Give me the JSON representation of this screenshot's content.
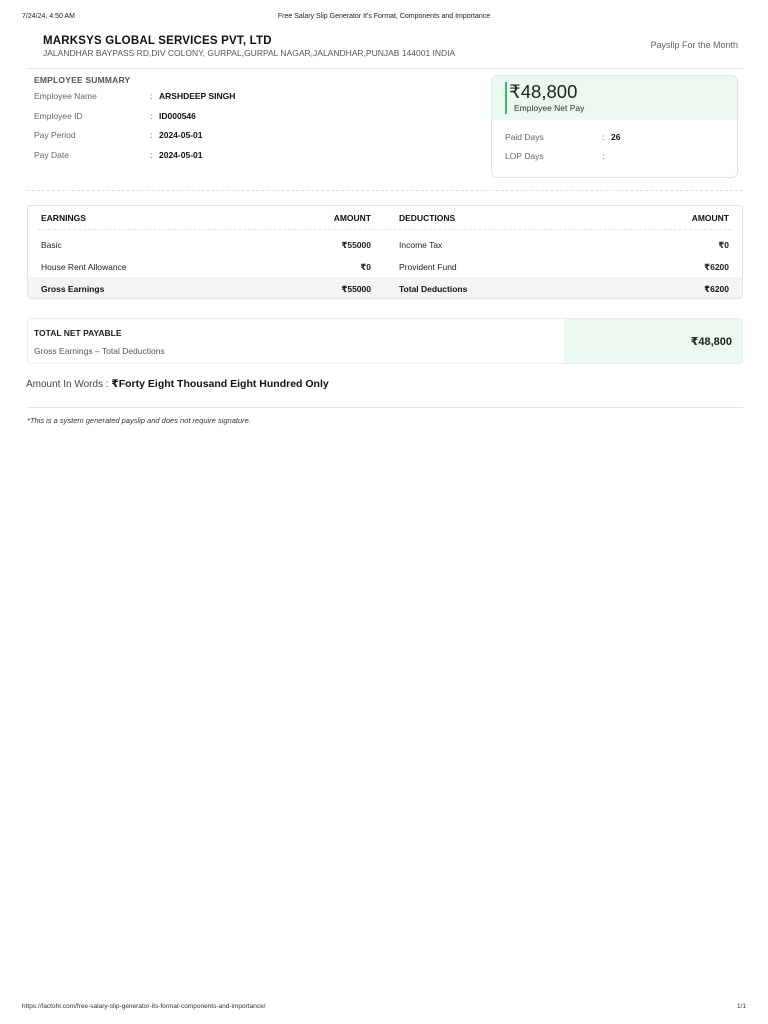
{
  "print_header": {
    "datetime": "7/24/24, 4:50 AM",
    "title": "Free Salary Slip Generator It's Format, Components and Importance"
  },
  "print_footer": {
    "url": "https://factohr.com/free-salary-slip-generator-its-format-components-and-importance/",
    "page": "1/1"
  },
  "company": {
    "name": "MARKSYS GLOBAL SERVICES PVT, LTD",
    "address": "JALANDHAR BAYPASS RD,DIV COLONY, GURPAL,GURPAL NAGAR,JALANDHAR,PUNJAB 144001 INDIA",
    "payslip_label": "Payslip For the Month"
  },
  "employee_summary": {
    "title": "EMPLOYEE SUMMARY",
    "fields": [
      {
        "label": "Employee Name",
        "value": "ARSHDEEP SINGH"
      },
      {
        "label": "Employee ID",
        "value": "ID000546"
      },
      {
        "label": "Pay Period",
        "value": "2024-05-01"
      },
      {
        "label": "Pay Date",
        "value": "2024-05-01"
      }
    ]
  },
  "net_pay_card": {
    "amount": "₹48,800",
    "label": "Employee Net Pay",
    "paid_days_label": "Paid Days",
    "paid_days_value": "26",
    "lop_days_label": "LOP Days",
    "lop_days_value": ""
  },
  "earnings_table": {
    "headers": {
      "earnings": "EARNINGS",
      "earnings_amount": "AMOUNT",
      "deductions": "DEDUCTIONS",
      "deductions_amount": "AMOUNT"
    },
    "rows": [
      {
        "earning": "Basic",
        "earning_amount": "₹55000",
        "deduction": "Income Tax",
        "deduction_amount": "₹0"
      },
      {
        "earning": "House Rent Allowance",
        "earning_amount": "₹0",
        "deduction": "Provident Fund",
        "deduction_amount": "₹6200"
      }
    ],
    "totals": {
      "earning": "Gross Earnings",
      "earning_amount": "₹55000",
      "deduction": "Total Deductions",
      "deduction_amount": "₹6200"
    }
  },
  "total_net_payable": {
    "title": "TOTAL NET PAYABLE",
    "subtitle": "Gross Earnings – Total Deductions",
    "amount": "₹48,800"
  },
  "amount_in_words": {
    "label": "Amount In Words :",
    "value": "₹Forty Eight Thousand Eight Hundred Only"
  },
  "note": "*This is a system generated payslip and does not require signature.",
  "colors": {
    "accent_green": "#3fb36a",
    "highlight_bg": "#eaf8ef"
  }
}
